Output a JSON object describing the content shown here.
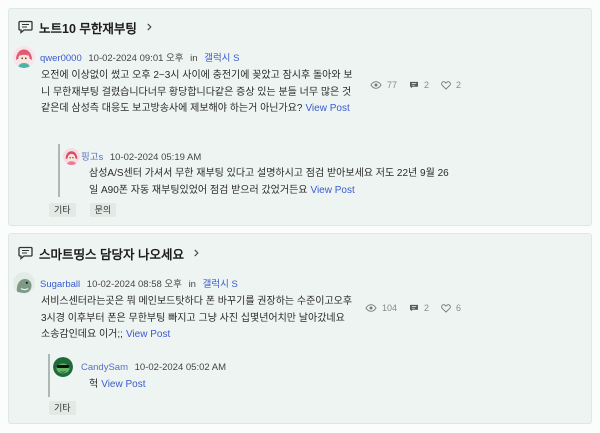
{
  "threads": [
    {
      "title": "노트10 무한재부팅",
      "post": {
        "author": "qwer0000",
        "date": "10-02-2024 09:01 오후",
        "in_label": "in",
        "board": "갤럭시 S",
        "body": "오전에 이상없이 썼고 오후 2~3시 사이에 충전기에 꽂았고 잠시후 돌아와 보니 무한재부팅 걸렸습니다너무 황당합니다같은 증상 있는 분들 너무 많은 것 같은데 삼성측 대응도 보고방송사에 제보해야 하는거 아닌가요?",
        "view_post": "View Post",
        "views": "77",
        "replies": "2",
        "likes": "2"
      },
      "reply": {
        "author": "핑고s",
        "date": "10-02-2024 05:19 AM",
        "body": "삼성A/S센터 가셔서 무한 재부팅 있다고 설명하시고 점검 받아보세요 저도 22년 9월 26일 A90폰 자동 재부팅있었어 점검 받으러 갔었거든요",
        "view_post": "View Post"
      },
      "tags": [
        "기타",
        "문의"
      ]
    },
    {
      "title": "스마트띵스 담당자 나오세요",
      "post": {
        "author": "Sugarball",
        "date": "10-02-2024 08:58 오후",
        "in_label": "in",
        "board": "갤럭시 S",
        "body": "서비스센터라는곳은 뭐 메인보드탓하다 폰 바꾸기를 권장하는 수준이고오후 3시경 이후부터 폰은 무한부팅 빠지고 그냥 사진 십몇년어치만 날아갔네요소송감인데요 이거;;",
        "view_post": "View Post",
        "views": "104",
        "replies": "2",
        "likes": "6"
      },
      "reply": {
        "author": "CandySam",
        "date": "10-02-2024 05:02 AM",
        "body": "헉",
        "view_post": "View Post"
      },
      "tags": [
        "기타"
      ]
    }
  ],
  "icons": {
    "thread": "chat-bubble-icon",
    "expand": "chevron-right-icon",
    "views": "eye-icon",
    "replies": "message-icon",
    "likes": "heart-icon"
  },
  "colors": {
    "card_background": "#eef4f1",
    "link": "#3a5bcf",
    "text": "#2a2a2a",
    "muted": "#8a8a8a"
  }
}
